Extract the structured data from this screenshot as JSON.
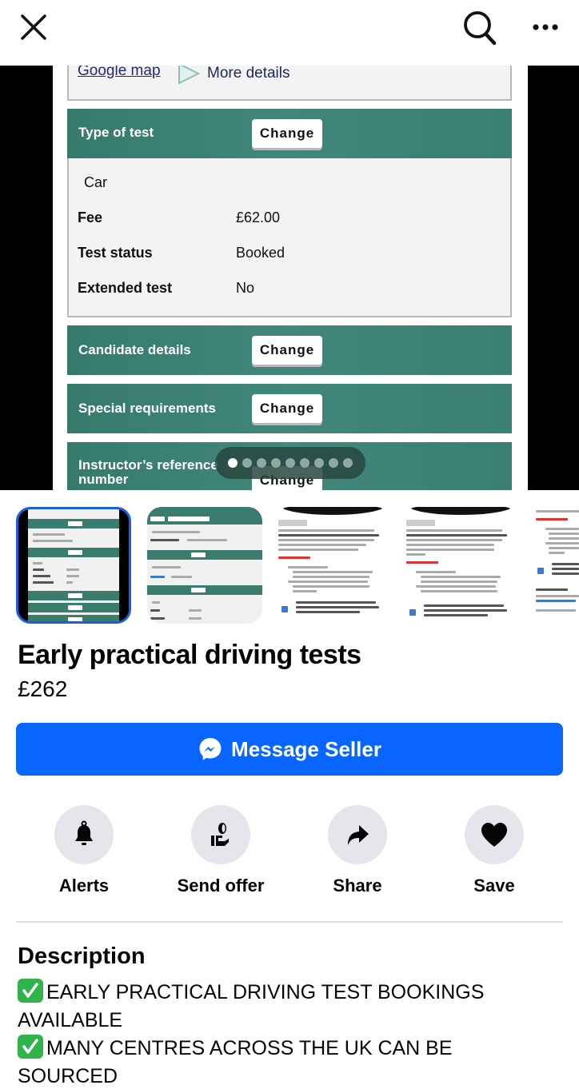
{
  "topbar": {
    "close_icon": "close-icon",
    "search_icon": "search-icon",
    "more_icon": "more-horizontal-icon"
  },
  "hero": {
    "map_link": "Google map",
    "more_details": "More details",
    "sections": {
      "type_of_test": "Type of test",
      "candidate_details": "Candidate details",
      "special_requirements": "Special requirements",
      "instructor_reference": "Instructor’s reference\nnumber"
    },
    "change_label": "Change",
    "test_type_value": "Car",
    "details": [
      {
        "key": "Fee",
        "value": "£62.00"
      },
      {
        "key": "Test status",
        "value": "Booked"
      },
      {
        "key": "Extended test",
        "value": "No"
      }
    ],
    "carousel": {
      "total": 9,
      "active_index": 0
    }
  },
  "thumbnails": {
    "count_visible": 5,
    "selected_index": 0
  },
  "listing": {
    "title": "Early practical driving tests",
    "price": "£262",
    "message_button": "Message Seller",
    "accent_color": "#0866ff"
  },
  "actions": [
    {
      "label": "Alerts",
      "icon": "bell-icon"
    },
    {
      "label": "Send offer",
      "icon": "hand-coin-icon"
    },
    {
      "label": "Share",
      "icon": "share-arrow-icon"
    },
    {
      "label": "Save",
      "icon": "heart-icon"
    }
  ],
  "description": {
    "heading": "Description",
    "lines": [
      "EARLY PRACTICAL DRIVING TEST BOOKINGS AVAILABLE",
      "MANY CENTRES ACROSS THE UK CAN BE SOURCED"
    ],
    "bullet_icon": "check-mark-button-icon"
  }
}
